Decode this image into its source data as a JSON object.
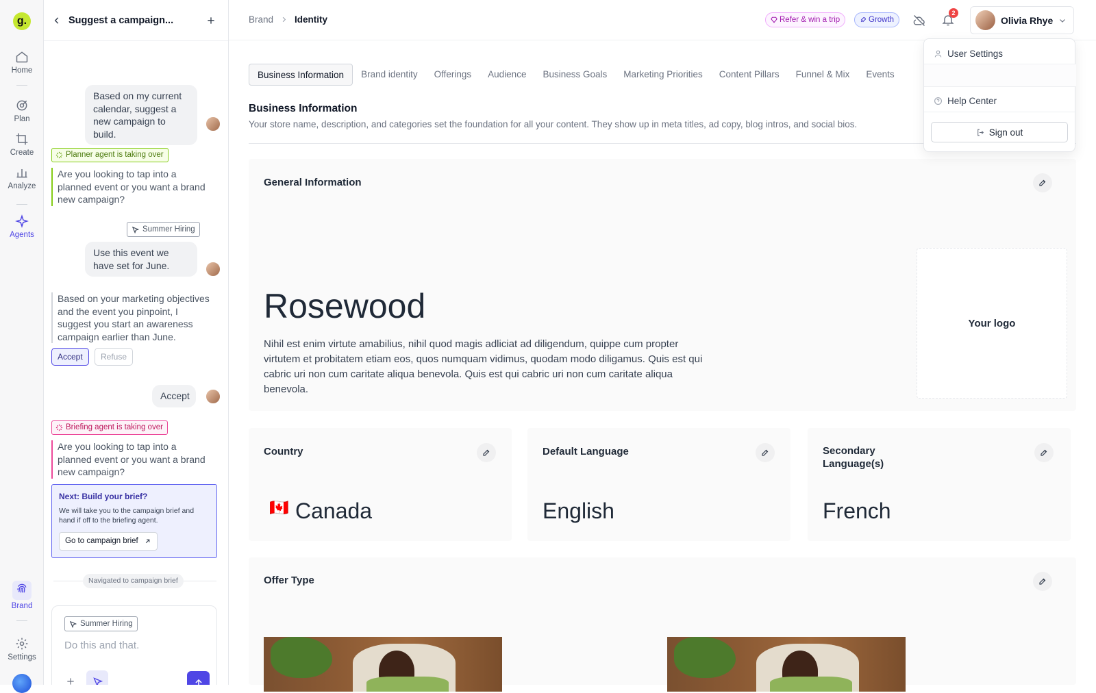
{
  "rail": {
    "logo": "g.",
    "items": [
      {
        "label": "Home",
        "icon": "home-icon"
      },
      {
        "label": "Plan",
        "icon": "target-icon"
      },
      {
        "label": "Create",
        "icon": "crop-icon"
      },
      {
        "label": "Analyze",
        "icon": "bar-chart-icon"
      },
      {
        "label": "Agents",
        "icon": "sparkle-icon"
      },
      {
        "label": "Brand",
        "icon": "fingerprint-icon"
      },
      {
        "label": "Settings",
        "icon": "gear-icon"
      }
    ]
  },
  "chat": {
    "title": "Suggest a campaign...",
    "messages": {
      "user1": "Based on my current calendar, suggest a new campaign to build.",
      "planner_tag": "Planner agent is taking over",
      "agent1": "Are you looking to tap into a planned event or you want a brand new campaign?",
      "event_chip": "Summer Hiring",
      "user2": "Use this event we have set for June.",
      "agent2": "Based on your marketing objectives and the event you pinpoint, I suggest you start an awareness campaign earlier than June.",
      "accept_label": "Accept",
      "refuse_label": "Refuse",
      "user3": "Accept",
      "briefing_tag": "Briefing agent is taking over",
      "agent3": "Are you looking to tap into a planned event or you want a brand new campaign?",
      "next_title": "Next: Build your brief?",
      "next_body": "We will take you to the campaign brief and hand if off to the briefing agent.",
      "next_button": "Go to campaign brief",
      "navigated": "Navigated to campaign brief"
    },
    "composer": {
      "chip": "Summer Hiring",
      "placeholder": "Do this and that."
    }
  },
  "topbar": {
    "breadcrumb": [
      "Brand",
      "Identity"
    ],
    "refer_label": "Refer & win a trip",
    "growth_label": "Growth",
    "notification_count": "2",
    "user_name": "Olivia Rhye"
  },
  "user_menu": {
    "settings": "User Settings",
    "help": "Help Center",
    "signout": "Sign out"
  },
  "tabs": [
    "Business Information",
    "Brand identity",
    "Offerings",
    "Audience",
    "Business Goals",
    "Marketing Priorities",
    "Content Pillars",
    "Funnel & Mix",
    "Events"
  ],
  "section": {
    "title": "Business Information",
    "description": "Your store name, description, and categories set the foundation for all your content. They show up in meta titles, ad copy, blog intros, and social bios."
  },
  "general": {
    "title": "General Information",
    "brand_name": "Rosewood",
    "description": "Nihil est enim virtute amabilius, nihil quod magis adliciat ad  diligendum, quippe cum propter virtutem et probitatem etiam eos, quos  numquam vidimus, quodam modo diligamus. Quis est qui cabric uri non cum caritate aliqua benevola. Quis est qui cabric uri non cum caritate aliqua benevola.",
    "logo_placeholder": "Your logo"
  },
  "country": {
    "title": "Country",
    "flag": "🇨🇦",
    "value": "Canada"
  },
  "default_language": {
    "title": "Default Language",
    "value": "English"
  },
  "secondary_language": {
    "title": "Secondary Language(s)",
    "value": "French"
  },
  "offer_type": {
    "title": "Offer Type"
  },
  "colors": {
    "accent": "#4f46e5",
    "brand_lime": "#c5e830",
    "planner_green": "#65a30d",
    "briefing_pink": "#db2777",
    "badge_red": "#ef4444"
  }
}
